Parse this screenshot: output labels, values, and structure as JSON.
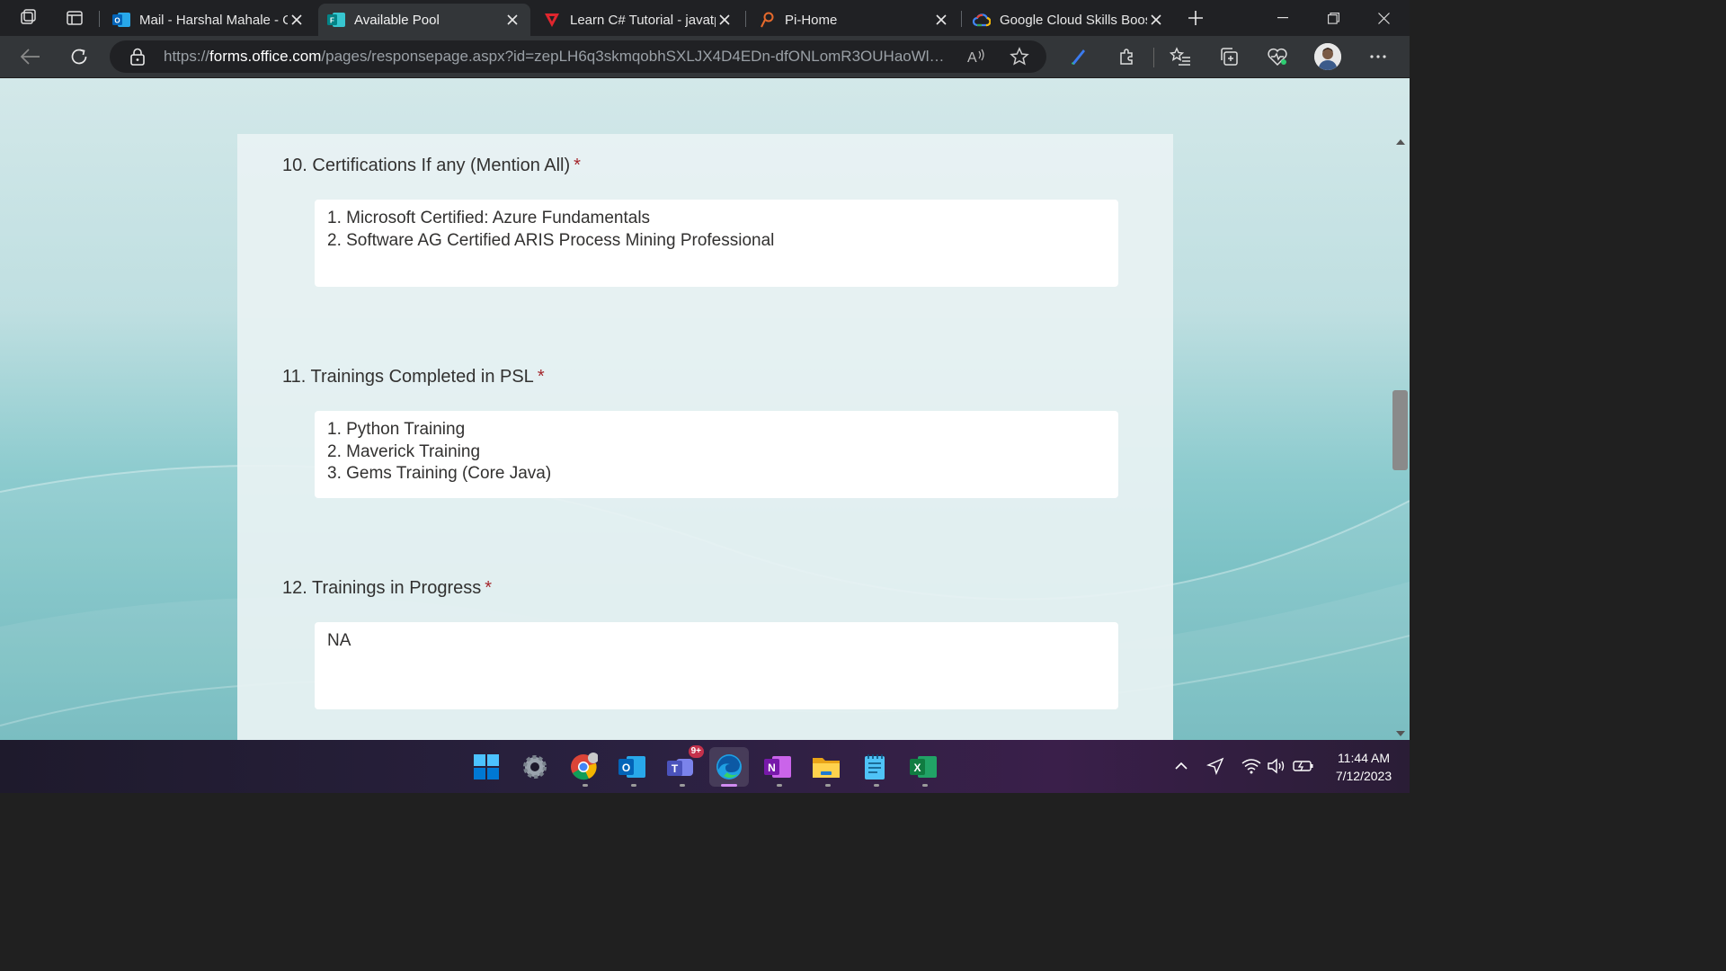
{
  "browser": {
    "tabs": [
      {
        "title": "Mail - Harshal Mahale - Outlook",
        "icon": "outlook-icon",
        "active": false
      },
      {
        "title": "Available Pool",
        "icon": "forms-icon",
        "active": true
      },
      {
        "title": "Learn C# Tutorial - javatpoint",
        "icon": "javatpoint-icon",
        "active": false
      },
      {
        "title": "Pi-Home",
        "icon": "pi-icon",
        "active": false
      },
      {
        "title": "Google Cloud Skills Boost",
        "icon": "google-cloud-icon",
        "active": false
      }
    ],
    "url_prefix": "https://",
    "url_host": "forms.office.com",
    "url_path": "/pages/responsepage.aspx?id=zepLH6q3skmqobhSXLJX4D4EDn-dfONLomR3OUHaoWlU..."
  },
  "form": {
    "questions": [
      {
        "number": "10.",
        "title": "Certifications If any (Mention All)",
        "required_mark": "*",
        "answer_lines": [
          "1. Microsoft Certified: Azure Fundamentals",
          "2. Software AG Certified ARIS Process Mining Professional"
        ]
      },
      {
        "number": "11.",
        "title": "Trainings Completed in PSL",
        "required_mark": "*",
        "answer_lines": [
          "1. Python Training",
          "2. Maverick Training",
          "3. Gems Training (Core Java)"
        ]
      },
      {
        "number": "12.",
        "title": "Trainings in Progress",
        "required_mark": "*",
        "answer_lines": [
          "NA"
        ]
      }
    ]
  },
  "taskbar": {
    "apps": [
      "windows-start-icon",
      "settings-icon",
      "chrome-icon",
      "outlook-icon",
      "teams-icon",
      "edge-icon",
      "onenote-icon",
      "file-explorer-icon",
      "notepad-icon",
      "excel-icon"
    ],
    "teams_badge": "9+",
    "time": "11:44 AM",
    "date": "7/12/2023"
  },
  "colors": {
    "required": "#a4262c",
    "tab_strip": "#202124",
    "toolbar": "#333639"
  }
}
